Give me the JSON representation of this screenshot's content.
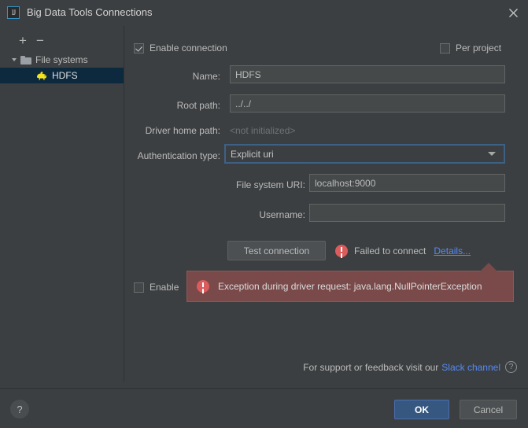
{
  "window": {
    "title": "Big Data Tools Connections",
    "app_icon": "intellij-idea-icon",
    "close_icon": "close-icon"
  },
  "sidebar": {
    "add_label": "+",
    "remove_label": "−",
    "tree": [
      {
        "label": "File systems",
        "icon": "folder-icon",
        "selected": false,
        "expanded": true
      },
      {
        "label": "HDFS",
        "icon": "hadoop-elephant-icon",
        "selected": true,
        "expanded": false
      }
    ]
  },
  "form": {
    "enable_connection": {
      "label": "Enable connection",
      "checked": true
    },
    "per_project": {
      "label": "Per project",
      "checked": false
    },
    "name": {
      "label": "Name:",
      "value": "HDFS"
    },
    "root_path": {
      "label": "Root path:",
      "value": "../../"
    },
    "driver_home_path": {
      "label": "Driver home path:",
      "value": "<not initialized>"
    },
    "auth_type": {
      "label": "Authentication type:",
      "value": "Explicit uri",
      "arrow_icon": "chevron-down-icon"
    },
    "file_system_uri": {
      "label": "File system URI:",
      "value": "localhost:9000"
    },
    "username": {
      "label": "Username:",
      "value": ""
    },
    "test_connection_label": "Test connection",
    "status": {
      "icon": "error-icon",
      "text": "Failed to connect",
      "details_link": "Details..."
    },
    "enable_bottom": {
      "label": "Enable",
      "checked": false
    }
  },
  "balloon": {
    "icon": "error-icon",
    "message": "Exception during driver request: java.lang.NullPointerException"
  },
  "footer": {
    "support_text": "For support or feedback visit our",
    "slack_link": "Slack channel",
    "help_badge_icon": "question-mark-icon",
    "help_button_label": "?",
    "ok_label": "OK",
    "cancel_label": "Cancel"
  },
  "colors": {
    "background": "#3c3f41",
    "accent_blue": "#365880",
    "link_blue": "#548af7",
    "error_red": "#db5c5c",
    "balloon_bg": "#7a4a4a",
    "selection_blue": "#0d293e"
  }
}
